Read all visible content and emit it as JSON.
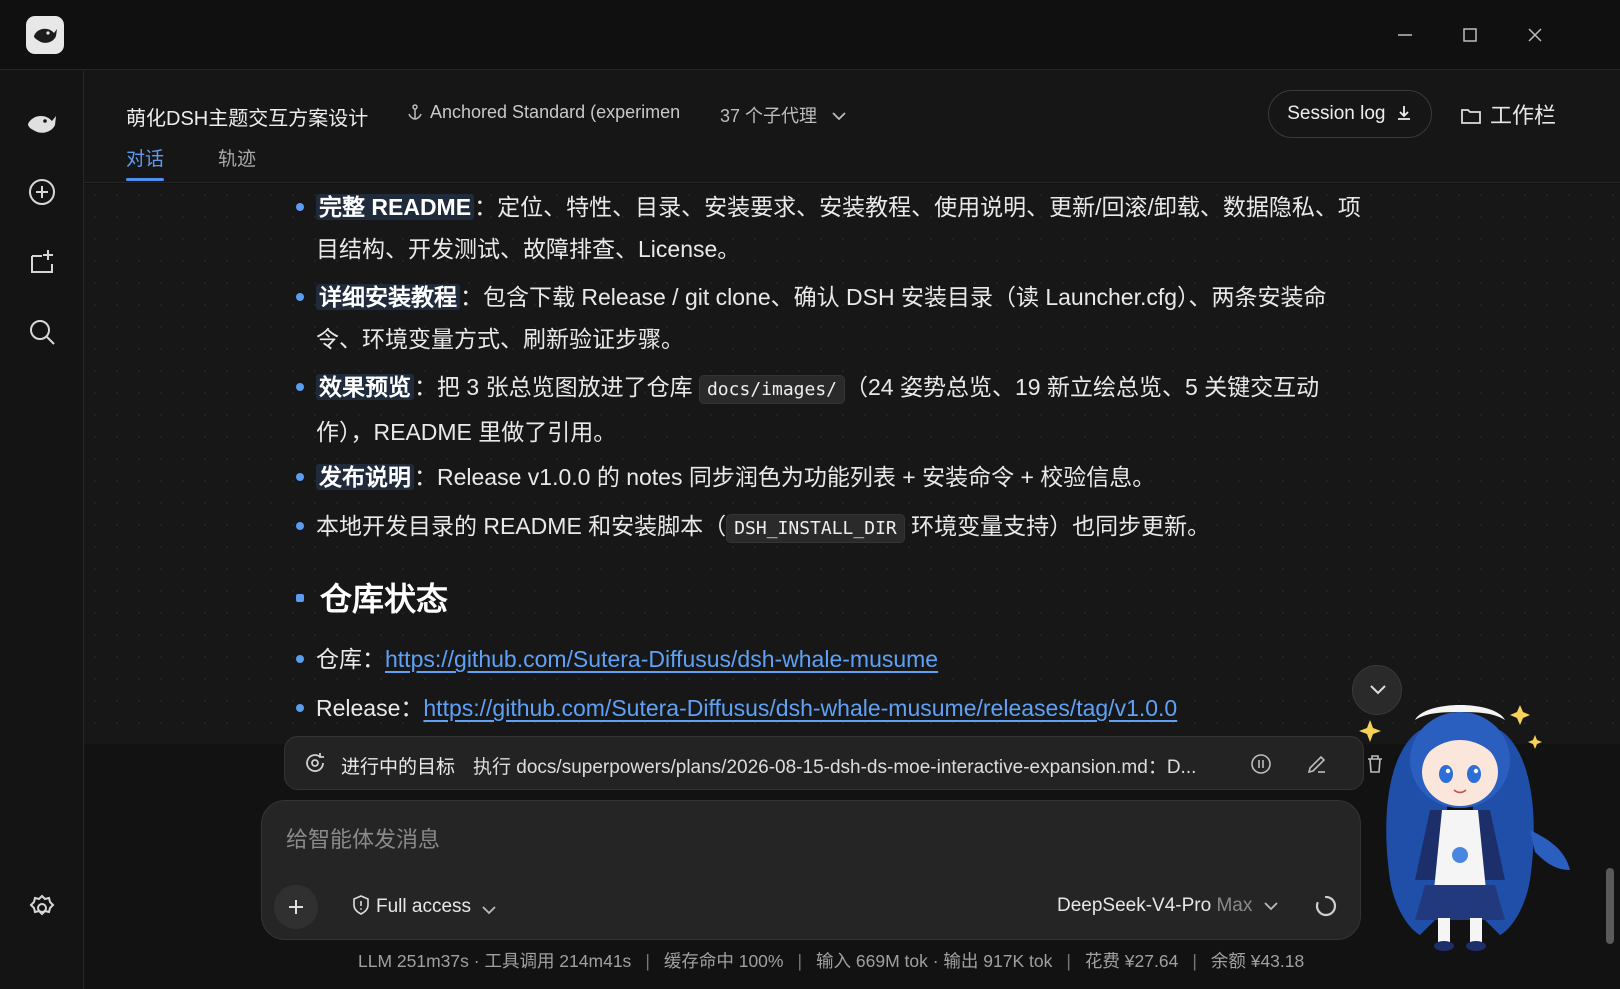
{
  "window": {
    "logo_icon": "whale-logo-icon",
    "controls": [
      "minimize-icon",
      "maximize-icon",
      "close-icon"
    ]
  },
  "sidebar": {
    "items": [
      "whale-home-icon",
      "new-chat-icon",
      "add-workspace-icon",
      "search-icon"
    ],
    "bottom": "settings-icon"
  },
  "header": {
    "title": "萌化DSH主题交互方案设计",
    "anchor": "Anchored Standard (experimen",
    "agents": "37 个子代理",
    "session_log": "Session log",
    "workbar": "工作栏",
    "tabs": [
      {
        "label": "对话",
        "active": true
      },
      {
        "label": "轨迹",
        "active": false
      }
    ]
  },
  "content": {
    "items": [
      {
        "head": "完整 README",
        "sep": "：",
        "line1": "定位、特性、目录、安装要求、安装教程、使用说明、更新/回滚/卸载、数据隐私、项",
        "line2": "目结构、开发测试、故障排查、License。"
      },
      {
        "head": "详细安装教程",
        "sep": "：",
        "line1": "包含下载 Release / git clone、确认 DSH 安装目录（读 Launcher.cfg）、两条安装命",
        "line2": "令、环境变量方式、刷新验证步骤。"
      },
      {
        "head": "效果预览",
        "sep": "：",
        "pre": "把 3 张总览图放进了仓库 ",
        "code": "docs/images/",
        "post": "（24 姿势总览、19 新立绘总览、5 关键交互动",
        "line2": "作），README 里做了引用。"
      },
      {
        "head": "发布说明",
        "sep": "：",
        "line1": "Release v1.0.0 的 notes 同步润色为功能列表 + 安装命令 + 校验信息。"
      },
      {
        "pre": "本地开发目录的 README 和安装脚本（",
        "code": "DSH_INSTALL_DIR",
        "post": " 环境变量支持）也同步更新。"
      }
    ],
    "section_title": "仓库状态",
    "repo_label": "仓库：",
    "repo_url": "https://github.com/Sutera-Diffusus/dsh-whale-musume",
    "release_label": "Release：",
    "release_url": "https://github.com/Sutera-Diffusus/dsh-whale-musume/releases/tag/v1.0.0"
  },
  "goal": {
    "label": "进行中的目标",
    "text": "执行 docs/superpowers/plans/2026-08-15-dsh-ds-moe-interactive-expansion.md：D..."
  },
  "composer": {
    "placeholder": "给智能体发消息",
    "access": "Full access",
    "model": "DeepSeek-V4-Pro",
    "model_mode": "Max"
  },
  "status": {
    "llm": "LLM 251m37s · 工具调用 214m41s",
    "cache": "缓存命中 100%",
    "tokens": "输入 669M tok · 输出 917K tok",
    "cost": "花费 ¥27.64",
    "balance": "余额 ¥43.18",
    "sep": "|"
  },
  "colors": {
    "accent": "#4f8ff0",
    "link": "#5ea1f7",
    "background": "#121212"
  }
}
